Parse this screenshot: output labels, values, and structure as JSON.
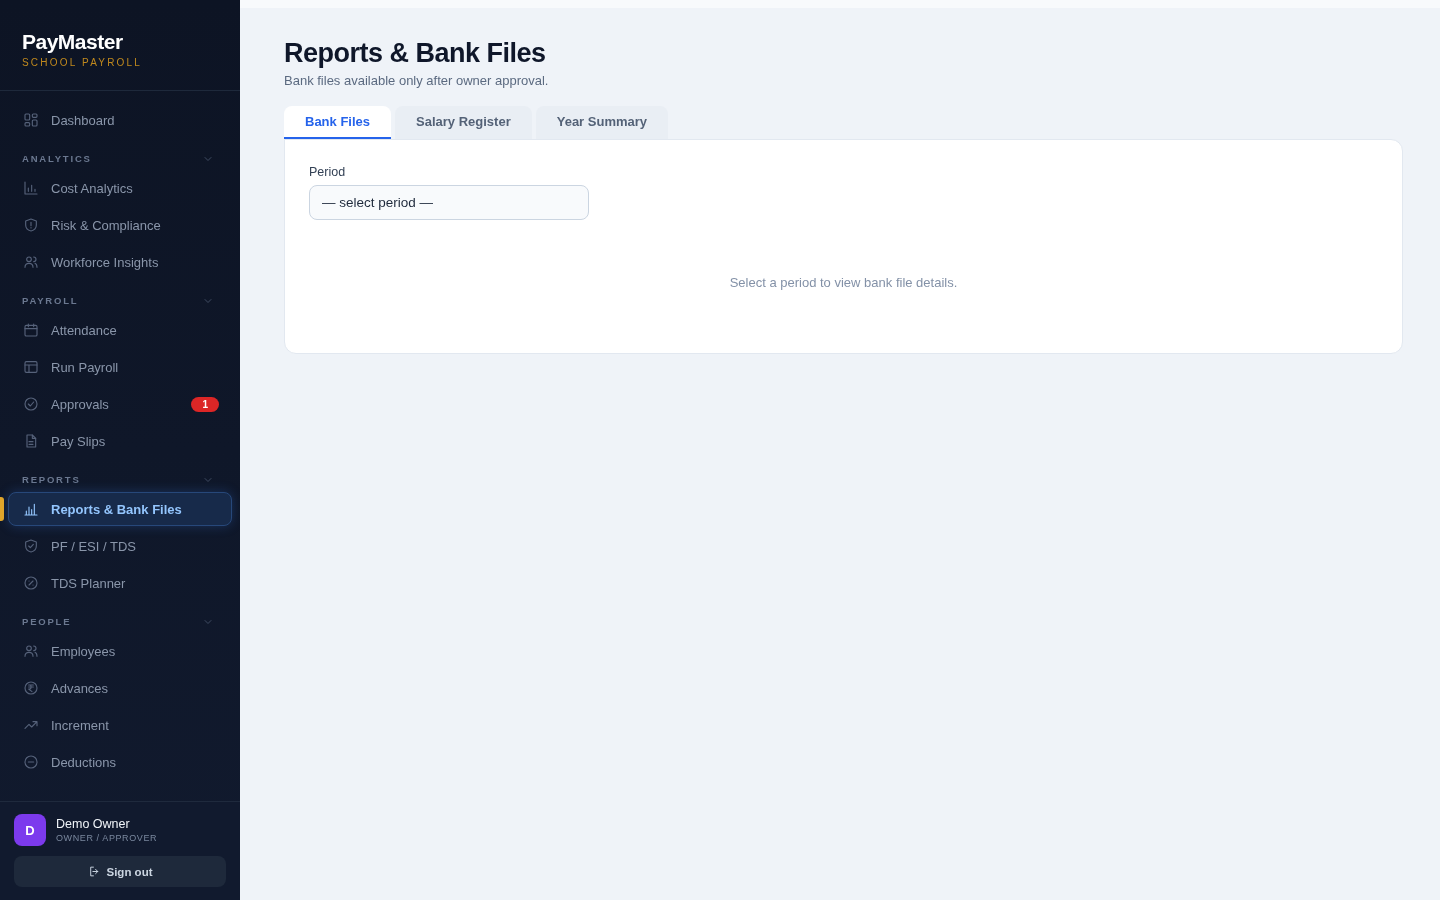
{
  "brand": {
    "name": "PayMaster",
    "tagline": "SCHOOL PAYROLL"
  },
  "nav": {
    "items": [
      {
        "label": "Dashboard",
        "selected": false
      }
    ],
    "sections": [
      {
        "heading": "ANALYTICS",
        "expanded": true,
        "items": [
          {
            "label": "Cost Analytics",
            "selected": false
          },
          {
            "label": "Risk & Compliance",
            "selected": false
          },
          {
            "label": "Workforce Insights",
            "selected": false
          }
        ]
      },
      {
        "heading": "PAYROLL",
        "expanded": true,
        "items": [
          {
            "label": "Attendance",
            "selected": false
          },
          {
            "label": "Run Payroll",
            "selected": false
          },
          {
            "label": "Approvals",
            "selected": false,
            "badge": "1"
          },
          {
            "label": "Pay Slips",
            "selected": false
          }
        ]
      },
      {
        "heading": "REPORTS",
        "expanded": true,
        "items": [
          {
            "label": "Reports & Bank Files",
            "selected": true
          },
          {
            "label": "PF / ESI / TDS",
            "selected": false
          },
          {
            "label": "TDS Planner",
            "selected": false
          }
        ]
      },
      {
        "heading": "PEOPLE",
        "expanded": true,
        "items": [
          {
            "label": "Employees",
            "selected": false
          },
          {
            "label": "Advances",
            "selected": false
          },
          {
            "label": "Increment",
            "selected": false
          },
          {
            "label": "Deductions",
            "selected": false
          }
        ]
      }
    ]
  },
  "user": {
    "initial": "D",
    "name": "Demo Owner",
    "role": "OWNER / APPROVER"
  },
  "sign_out": "Sign out",
  "page": {
    "title": "Reports & Bank Files",
    "subtitle": "Bank files available only after owner approval."
  },
  "tabs": [
    {
      "label": "Bank Files",
      "selected": true
    },
    {
      "label": "Salary Register",
      "selected": false
    },
    {
      "label": "Year Summary",
      "selected": false
    }
  ],
  "period": {
    "label": "Period",
    "placeholder": "— select period —"
  },
  "empty_message": "Select a period to view bank file details."
}
